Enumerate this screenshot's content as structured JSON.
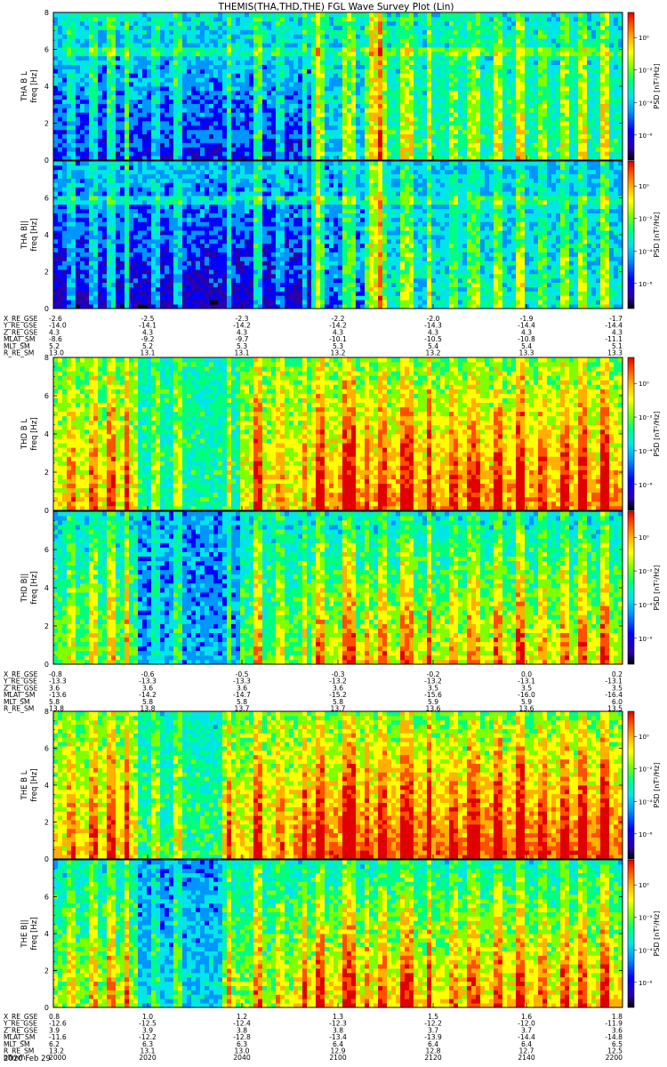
{
  "title": "THEMIS(THA,THD,THE) FGL Wave Survey Plot (Lin)",
  "date_label": "2020 Feb 29",
  "colorbar": {
    "title": "PSD [nT²/Hz]",
    "ticks": [
      "10⁰",
      "10⁻²",
      "10⁻⁴",
      "10⁻⁶"
    ],
    "colors": [
      "#000000",
      "#2a00a8",
      "#0000ff",
      "#0096ff",
      "#00e6e6",
      "#00ff80",
      "#7fff00",
      "#ffff00",
      "#ffb000",
      "#ff5000",
      "#e00000"
    ]
  },
  "chart_data": [
    {
      "type": "heatmap",
      "panel": "THA B L",
      "ylabel": "THA B L\nfreq [Hz]",
      "ylim": [
        0,
        8
      ],
      "yticks": [
        "0",
        "2",
        "4",
        "6",
        "8"
      ],
      "description_of_structure": "broadband spectrogram, low power in first third, strong vertical burst near 20:35"
    },
    {
      "type": "heatmap",
      "panel": "THA B||",
      "ylabel": "THA B||\nfreq [Hz]",
      "ylim": [
        0,
        8
      ],
      "yticks": [
        "0",
        "2",
        "4",
        "6"
      ]
    },
    {
      "type": "heatmap",
      "panel": "THD B L",
      "ylabel": "THD B L\nfreq [Hz]",
      "ylim": [
        0,
        8
      ],
      "yticks": [
        "0",
        "2",
        "4",
        "6",
        "8"
      ]
    },
    {
      "type": "heatmap",
      "panel": "THD B||",
      "ylabel": "THD B||\nfreq [Hz]",
      "ylim": [
        0,
        8
      ],
      "yticks": [
        "0",
        "2",
        "4",
        "6"
      ]
    },
    {
      "type": "heatmap",
      "panel": "THE B L",
      "ylabel": "THE B L\nfreq [Hz]",
      "ylim": [
        0,
        8
      ],
      "yticks": [
        "0",
        "2",
        "4",
        "6",
        "8"
      ]
    },
    {
      "type": "heatmap",
      "panel": "THE B||",
      "ylabel": "THE B||\nfreq [Hz]",
      "ylim": [
        0,
        8
      ],
      "yticks": [
        "0",
        "2",
        "4",
        "6"
      ]
    }
  ],
  "ephemeris_blocks": [
    {
      "rows": [
        {
          "label": "X_RE_GSE",
          "values": [
            "-2.6",
            "-2.5",
            "-2.3",
            "-2.2",
            "-2.0",
            "-1.9",
            "-1.7"
          ]
        },
        {
          "label": "Y_RE_GSE",
          "values": [
            "-14.0",
            "-14.1",
            "-14.2",
            "-14.2",
            "-14.3",
            "-14.4",
            "-14.4"
          ]
        },
        {
          "label": "Z_RE_GSE",
          "values": [
            "4.3",
            "4.3",
            "4.3",
            "4.3",
            "4.3",
            "4.3",
            "4.3"
          ]
        },
        {
          "label": "MLAT_SM",
          "values": [
            "-8.6",
            "-9.2",
            "-9.7",
            "-10.1",
            "-10.5",
            "-10.8",
            "-11.1"
          ]
        },
        {
          "label": "MLT_SM",
          "values": [
            "5.2",
            "5.2",
            "5.3",
            "5.3",
            "5.4",
            "5.4",
            "5.1"
          ]
        },
        {
          "label": "R_RE_SM",
          "values": [
            "13.0",
            "13.1",
            "13.1",
            "13.2",
            "13.2",
            "13.3",
            "13.3"
          ]
        }
      ]
    },
    {
      "rows": [
        {
          "label": "X_RE_GSE",
          "values": [
            "-0.8",
            "-0.6",
            "-0.5",
            "-0.3",
            "-0.2",
            "0.0",
            "0.2"
          ]
        },
        {
          "label": "Y_RE_GSE",
          "values": [
            "-13.3",
            "-13.3",
            "-13.3",
            "-13.2",
            "-13.2",
            "-13.1",
            "-13.1"
          ]
        },
        {
          "label": "Z_RE_GSE",
          "values": [
            "3.6",
            "3.6",
            "3.6",
            "3.6",
            "3.5",
            "3.5",
            "3.5"
          ]
        },
        {
          "label": "MLAT_SM",
          "values": [
            "-13.6",
            "-14.2",
            "-14.7",
            "-15.2",
            "-15.6",
            "-16.0",
            "-16.4"
          ]
        },
        {
          "label": "MLT_SM",
          "values": [
            "5.8",
            "5.8",
            "5.8",
            "5.8",
            "5.9",
            "5.9",
            "6.0"
          ]
        },
        {
          "label": "R_RE_SM",
          "values": [
            "13.8",
            "13.8",
            "13.7",
            "13.7",
            "13.6",
            "13.6",
            "13.5"
          ]
        }
      ]
    },
    {
      "rows": [
        {
          "label": "X_RE_GSE",
          "values": [
            "0.8",
            "1.0",
            "1.2",
            "1.3",
            "1.5",
            "1.6",
            "1.8"
          ]
        },
        {
          "label": "Y_RE_GSE",
          "values": [
            "-12.6",
            "-12.5",
            "-12.4",
            "-12.3",
            "-12.2",
            "-12.0",
            "-11.9"
          ]
        },
        {
          "label": "Z_RE_GSE",
          "values": [
            "3.9",
            "3.9",
            "3.8",
            "3.8",
            "3.7",
            "3.7",
            "3.6"
          ]
        },
        {
          "label": "MLAT_SM",
          "values": [
            "-11.6",
            "-12.2",
            "-12.8",
            "-13.4",
            "-13.9",
            "-14.4",
            "-14.8"
          ]
        },
        {
          "label": "MLT_SM",
          "values": [
            "6.2",
            "6.3",
            "6.3",
            "6.4",
            "6.4",
            "6.4",
            "6.5"
          ]
        },
        {
          "label": "R_RE_SM",
          "values": [
            "13.2",
            "13.1",
            "13.0",
            "12.9",
            "12.8",
            "12.7",
            "12.5"
          ]
        },
        {
          "label": "hhmm",
          "values": [
            "2000",
            "2020",
            "2040",
            "2100",
            "2120",
            "2140",
            "2200"
          ]
        }
      ]
    }
  ]
}
